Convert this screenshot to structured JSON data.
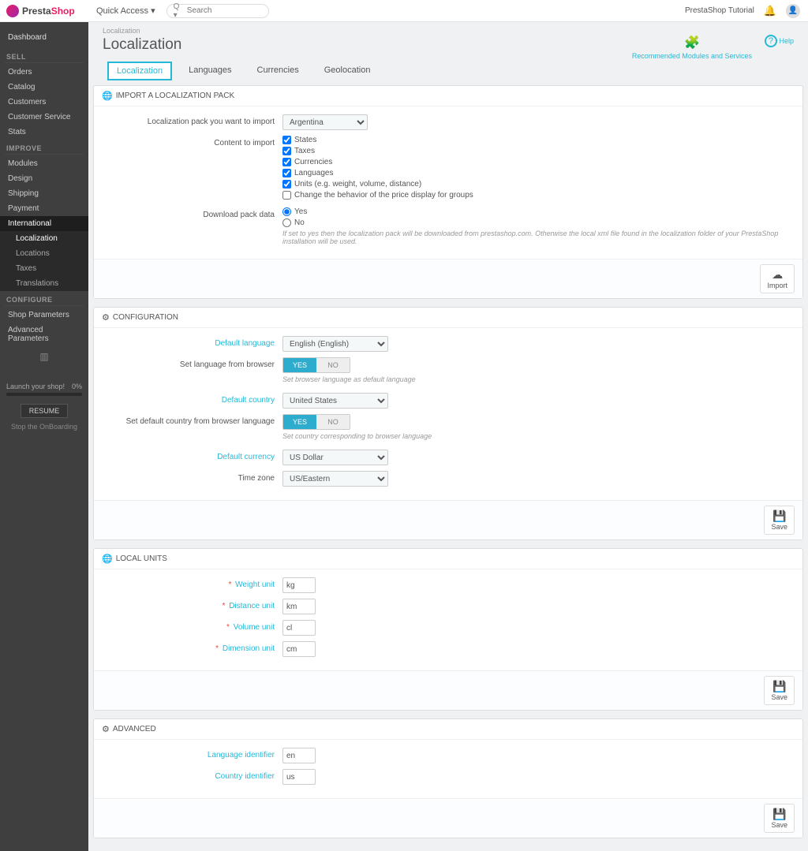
{
  "logo": {
    "text1": "Presta",
    "text2": "Shop"
  },
  "topbar": {
    "quick_access": "Quick Access",
    "search_placeholder": "Search",
    "tutorial": "PrestaShop Tutorial"
  },
  "sidebar": {
    "dashboard": "Dashboard",
    "sections": {
      "sell": "SELL",
      "improve": "IMPROVE",
      "configure": "CONFIGURE"
    },
    "sell_items": [
      "Orders",
      "Catalog",
      "Customers",
      "Customer Service",
      "Stats"
    ],
    "improve_items": [
      "Modules",
      "Design",
      "Shipping",
      "Payment",
      "International"
    ],
    "intl_sub": [
      "Localization",
      "Locations",
      "Taxes",
      "Translations"
    ],
    "configure_items": [
      "Shop Parameters",
      "Advanced Parameters"
    ],
    "launch": {
      "label": "Launch your shop!",
      "pct": "0%",
      "resume": "RESUME",
      "stop": "Stop the OnBoarding"
    }
  },
  "header": {
    "breadcrumb": "Localization",
    "title": "Localization",
    "rec": "Recommended Modules and Services",
    "help": "Help"
  },
  "tabs": [
    "Localization",
    "Languages",
    "Currencies",
    "Geolocation"
  ],
  "panel_import": {
    "title": "IMPORT A LOCALIZATION PACK",
    "pack_label": "Localization pack you want to import",
    "pack_value": "Argentina",
    "content_label": "Content to import",
    "checks": [
      "States",
      "Taxes",
      "Currencies",
      "Languages",
      "Units (e.g. weight, volume, distance)",
      "Change the behavior of the price display for groups"
    ],
    "download_label": "Download pack data",
    "yes": "Yes",
    "no": "No",
    "help": "If set to yes then the localization pack will be downloaded from prestashop.com. Otherwise the local xml file found in the localization folder of your PrestaShop installation will be used.",
    "import_btn": "Import"
  },
  "panel_config": {
    "title": "CONFIGURATION",
    "default_lang": "Default language",
    "default_lang_val": "English (English)",
    "lang_browser": "Set language from browser",
    "lang_browser_help": "Set browser language as default language",
    "default_country": "Default country",
    "default_country_val": "United States",
    "country_browser": "Set default country from browser language",
    "country_browser_help": "Set country corresponding to browser language",
    "default_currency": "Default currency",
    "default_currency_val": "US Dollar",
    "timezone": "Time zone",
    "timezone_val": "US/Eastern",
    "yes": "YES",
    "no": "NO",
    "save": "Save"
  },
  "panel_units": {
    "title": "LOCAL UNITS",
    "weight": "Weight unit",
    "weight_val": "kg",
    "distance": "Distance unit",
    "distance_val": "km",
    "volume": "Volume unit",
    "volume_val": "cl",
    "dimension": "Dimension unit",
    "dimension_val": "cm",
    "save": "Save"
  },
  "panel_adv": {
    "title": "ADVANCED",
    "lang_id": "Language identifier",
    "lang_id_val": "en",
    "country_id": "Country identifier",
    "country_id_val": "us",
    "save": "Save"
  }
}
